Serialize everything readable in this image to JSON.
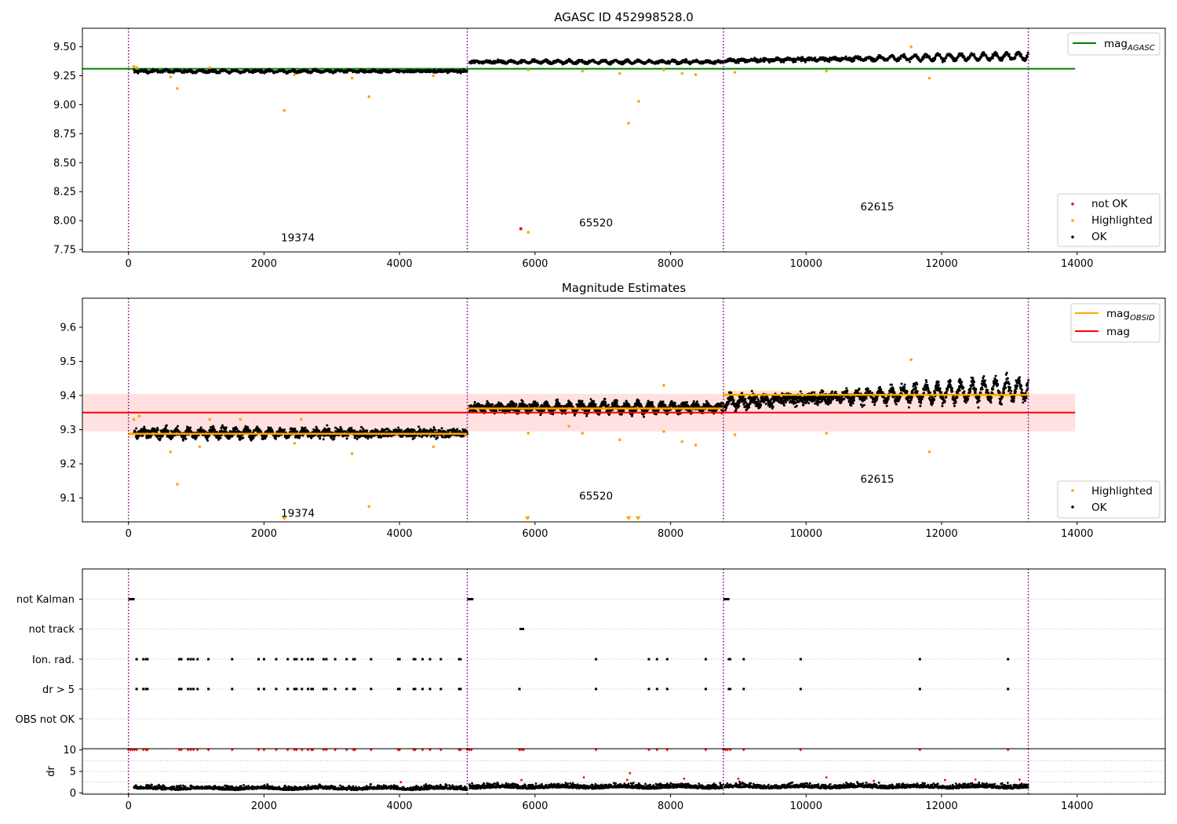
{
  "figure": {
    "colors": {
      "ok": "#000000",
      "highlighted": "#ffa500",
      "not_ok": "#ff0000",
      "agasc_line": "#008000",
      "obsid_line": "#ffa500",
      "mag_line": "#ff0000",
      "mag_band": "#ffc8c8",
      "obs_boundary": "#800080",
      "grid": "#b0b0b0"
    },
    "obsids": [
      {
        "obsid": "19374",
        "start": 0,
        "end": 5000,
        "mag_obsid": 9.288
      },
      {
        "obsid": "65520",
        "start": 5000,
        "end": 8780,
        "mag_obsid": 9.362
      },
      {
        "obsid": "62615",
        "start": 8780,
        "end": 13280,
        "mag_obsid": 9.402
      }
    ]
  },
  "chart_data": [
    {
      "type": "scatter",
      "title": "AGASC ID 452998528.0",
      "xlim": [
        -680,
        15300
      ],
      "ylim": [
        7.73,
        9.66
      ],
      "xticks": [
        0,
        2000,
        4000,
        6000,
        8000,
        10000,
        12000,
        14000
      ],
      "xtick_labels": [
        "0",
        "2000",
        "4000",
        "6000",
        "8000",
        "10000",
        "12000",
        "14000"
      ],
      "yticks": [
        7.75,
        8.0,
        8.25,
        8.5,
        8.75,
        9.0,
        9.25,
        9.5
      ],
      "ytick_labels": [
        "7.75",
        "8.00",
        "8.25",
        "8.50",
        "8.75",
        "9.00",
        "9.25",
        "9.50"
      ],
      "hlines": [
        {
          "name": "mag_AGASC",
          "y": 9.31,
          "x": [
            -680,
            13970
          ]
        }
      ],
      "obsid_labels": [
        {
          "text": "19374",
          "x": 2500,
          "y": 7.82
        },
        {
          "text": "65520",
          "x": 6900,
          "y": 7.95
        },
        {
          "text": "62615",
          "x": 11050,
          "y": 8.09
        }
      ],
      "ok_segments": [
        {
          "x": [
            80,
            5000
          ],
          "base": 9.29,
          "amp": 0.009,
          "noise": 0.012
        },
        {
          "x": [
            5030,
            8780
          ],
          "base": 9.37,
          "amp": 0.012,
          "noise": 0.012
        },
        {
          "x": [
            8800,
            13280
          ],
          "base": 9.4,
          "amp": 0.028,
          "noise": 0.016,
          "trend": 0.04
        }
      ],
      "highlighted_points": [
        {
          "x": 80,
          "y": 9.33
        },
        {
          "x": 120,
          "y": 9.32
        },
        {
          "x": 620,
          "y": 9.24
        },
        {
          "x": 720,
          "y": 9.14
        },
        {
          "x": 1200,
          "y": 9.32
        },
        {
          "x": 2300,
          "y": 8.95
        },
        {
          "x": 2450,
          "y": 9.26
        },
        {
          "x": 3300,
          "y": 9.23
        },
        {
          "x": 3550,
          "y": 9.07
        },
        {
          "x": 4500,
          "y": 9.25
        },
        {
          "x": 5900,
          "y": 9.3
        },
        {
          "x": 6700,
          "y": 9.29
        },
        {
          "x": 7250,
          "y": 9.27
        },
        {
          "x": 7380,
          "y": 8.84
        },
        {
          "x": 7530,
          "y": 9.03
        },
        {
          "x": 7900,
          "y": 9.3
        },
        {
          "x": 8170,
          "y": 9.27
        },
        {
          "x": 8370,
          "y": 9.26
        },
        {
          "x": 8950,
          "y": 9.28
        },
        {
          "x": 10300,
          "y": 9.29
        },
        {
          "x": 11550,
          "y": 9.5
        },
        {
          "x": 11820,
          "y": 9.23
        },
        {
          "x": 5900,
          "y": 7.9
        }
      ],
      "not_ok_points": [
        {
          "x": 5790,
          "y": 7.93
        }
      ],
      "legends": [
        {
          "position": "upper right",
          "entries": [
            {
              "label": "mag",
              "sub": "AGASC",
              "kind": "line",
              "color": "#008000"
            }
          ]
        },
        {
          "position": "lower right",
          "entries": [
            {
              "label": "not OK",
              "kind": "dot",
              "color": "#ff0000"
            },
            {
              "label": "Highlighted",
              "kind": "dot",
              "color": "#ffa500"
            },
            {
              "label": "OK",
              "kind": "dot",
              "color": "#000000"
            }
          ]
        }
      ]
    },
    {
      "type": "scatter",
      "title": "Magnitude Estimates",
      "xlim": [
        -680,
        15300
      ],
      "ylim": [
        9.03,
        9.685
      ],
      "xticks": [
        0,
        2000,
        4000,
        6000,
        8000,
        10000,
        12000,
        14000
      ],
      "xtick_labels": [
        "0",
        "2000",
        "4000",
        "6000",
        "8000",
        "10000",
        "12000",
        "14000"
      ],
      "yticks": [
        9.1,
        9.2,
        9.3,
        9.4,
        9.5,
        9.6
      ],
      "ytick_labels": [
        "9.1",
        "9.2",
        "9.3",
        "9.4",
        "9.5",
        "9.6"
      ],
      "mag": {
        "y": 9.35,
        "band": [
          9.295,
          9.405
        ],
        "x": [
          -680,
          13970
        ]
      },
      "obsid_labels": [
        {
          "text": "19374",
          "x": 2500,
          "y": 9.045
        },
        {
          "text": "65520",
          "x": 6900,
          "y": 9.095
        },
        {
          "text": "62615",
          "x": 11050,
          "y": 9.145
        }
      ],
      "ok_segments": [
        {
          "x": [
            80,
            5000
          ],
          "base": 9.29,
          "amp": 0.009,
          "noise": 0.012
        },
        {
          "x": [
            5030,
            8780
          ],
          "base": 9.365,
          "amp": 0.012,
          "noise": 0.012
        },
        {
          "x": [
            8800,
            13280
          ],
          "base": 9.4,
          "amp": 0.028,
          "noise": 0.016,
          "trend": 0.04
        }
      ],
      "highlighted_points": [
        {
          "x": 80,
          "y": 9.33
        },
        {
          "x": 160,
          "y": 9.34
        },
        {
          "x": 620,
          "y": 9.235
        },
        {
          "x": 720,
          "y": 9.14
        },
        {
          "x": 1050,
          "y": 9.25
        },
        {
          "x": 1200,
          "y": 9.33
        },
        {
          "x": 1650,
          "y": 9.33
        },
        {
          "x": 2450,
          "y": 9.26
        },
        {
          "x": 2550,
          "y": 9.33
        },
        {
          "x": 3300,
          "y": 9.23
        },
        {
          "x": 3550,
          "y": 9.075
        },
        {
          "x": 4500,
          "y": 9.25
        },
        {
          "x": 5900,
          "y": 9.29
        },
        {
          "x": 6500,
          "y": 9.31
        },
        {
          "x": 6700,
          "y": 9.29
        },
        {
          "x": 7250,
          "y": 9.27
        },
        {
          "x": 7900,
          "y": 9.295
        },
        {
          "x": 7900,
          "y": 9.43
        },
        {
          "x": 8170,
          "y": 9.265
        },
        {
          "x": 8370,
          "y": 9.255
        },
        {
          "x": 8950,
          "y": 9.285
        },
        {
          "x": 10300,
          "y": 9.29
        },
        {
          "x": 11550,
          "y": 9.505
        },
        {
          "x": 11820,
          "y": 9.235
        }
      ],
      "clipped_points": [
        {
          "x": 2300
        },
        {
          "x": 5890
        },
        {
          "x": 7380
        },
        {
          "x": 7520
        }
      ],
      "legends": [
        {
          "position": "upper right",
          "entries": [
            {
              "label": "mag",
              "sub": "OBSID",
              "kind": "line",
              "color": "#ffa500"
            },
            {
              "label": "mag",
              "kind": "line",
              "color": "#ff0000"
            }
          ]
        },
        {
          "position": "lower right",
          "entries": [
            {
              "label": "Highlighted",
              "kind": "dot",
              "color": "#ffa500"
            },
            {
              "label": "OK",
              "kind": "dot",
              "color": "#000000"
            }
          ]
        }
      ]
    },
    {
      "type": "scatter",
      "title": "",
      "xlim": [
        -680,
        15300
      ],
      "categories": [
        "not Kalman",
        "not track",
        "Ion. rad.",
        "dr > 5",
        "OBS not OK"
      ],
      "flags": {
        "not Kalman": [
          {
            "x": [
              0,
              90
            ]
          },
          {
            "x": [
              5000,
              5090
            ]
          },
          {
            "x": [
              8780,
              8870
            ]
          }
        ],
        "not track": [
          {
            "x": [
              5770,
              5840
            ]
          }
        ],
        "Ion. rad.": [
          120,
          220,
          260,
          280,
          750,
          780,
          880,
          920,
          960,
          1020,
          1180,
          1530,
          1920,
          2000,
          2180,
          2350,
          2450,
          2480,
          2560,
          2650,
          2700,
          2720,
          2880,
          2920,
          3050,
          3220,
          3320,
          3340,
          3580,
          3980,
          4000,
          4210,
          4230,
          4340,
          4450,
          4610,
          4880,
          4900,
          6900,
          7680,
          7800,
          7950,
          8520,
          8860,
          8880,
          9080,
          9920,
          11680,
          12980
        ],
        "dr > 5": [
          120,
          220,
          260,
          280,
          750,
          780,
          880,
          920,
          960,
          1020,
          1180,
          1530,
          1920,
          2000,
          2180,
          2350,
          2450,
          2480,
          2560,
          2650,
          2700,
          2720,
          2880,
          2920,
          3050,
          3220,
          3320,
          3340,
          3580,
          3980,
          4000,
          4210,
          4230,
          4340,
          4450,
          4610,
          4880,
          4900,
          5770,
          6900,
          7680,
          7800,
          7950,
          8520,
          8860,
          8880,
          9080,
          9920,
          11680,
          12980
        ],
        "OBS not OK": []
      }
    },
    {
      "type": "scatter",
      "title": "",
      "ylabel": "dr",
      "xlim": [
        -680,
        15300
      ],
      "ylim": [
        -0.3,
        10.3
      ],
      "yticks": [
        0,
        5,
        10
      ],
      "ytick_labels": [
        "0",
        "5",
        "10"
      ],
      "xticks": [
        0,
        2000,
        4000,
        6000,
        8000,
        10000,
        12000,
        14000
      ],
      "xtick_labels": [
        "0",
        "2000",
        "4000",
        "6000",
        "8000",
        "10000",
        "12000",
        "14000"
      ],
      "dr_segments": [
        {
          "x": [
            80,
            5000
          ],
          "base": 0.8,
          "noise": 0.4
        },
        {
          "x": [
            5030,
            8780
          ],
          "base": 1.1,
          "noise": 0.45
        },
        {
          "x": [
            8800,
            13280
          ],
          "base": 1.15,
          "noise": 0.45
        }
      ],
      "clipped_red_x": [
        0,
        30,
        60,
        90,
        120,
        220,
        260,
        280,
        750,
        780,
        880,
        920,
        960,
        1020,
        1180,
        1530,
        1920,
        2000,
        2180,
        2350,
        2450,
        2480,
        2560,
        2650,
        2700,
        2720,
        2880,
        2920,
        3050,
        3220,
        3320,
        3340,
        3580,
        3980,
        4000,
        4210,
        4230,
        4340,
        4450,
        4610,
        4880,
        4900,
        5000,
        5030,
        5060,
        5770,
        5800,
        5830,
        6900,
        7680,
        7800,
        7950,
        8520,
        8780,
        8810,
        8840,
        8880,
        9080,
        9920,
        11680,
        12980
      ],
      "red_points": [
        {
          "x": 5800,
          "y": 3.0
        },
        {
          "x": 6720,
          "y": 3.6
        },
        {
          "x": 7400,
          "y": 4.6
        },
        {
          "x": 7360,
          "y": 3.0
        },
        {
          "x": 8200,
          "y": 3.3
        },
        {
          "x": 9000,
          "y": 3.3
        },
        {
          "x": 10300,
          "y": 3.6
        },
        {
          "x": 11000,
          "y": 2.8
        },
        {
          "x": 12050,
          "y": 3.0
        },
        {
          "x": 12500,
          "y": 3.1
        },
        {
          "x": 13150,
          "y": 3.1
        },
        {
          "x": 4020,
          "y": 2.5
        }
      ]
    }
  ]
}
